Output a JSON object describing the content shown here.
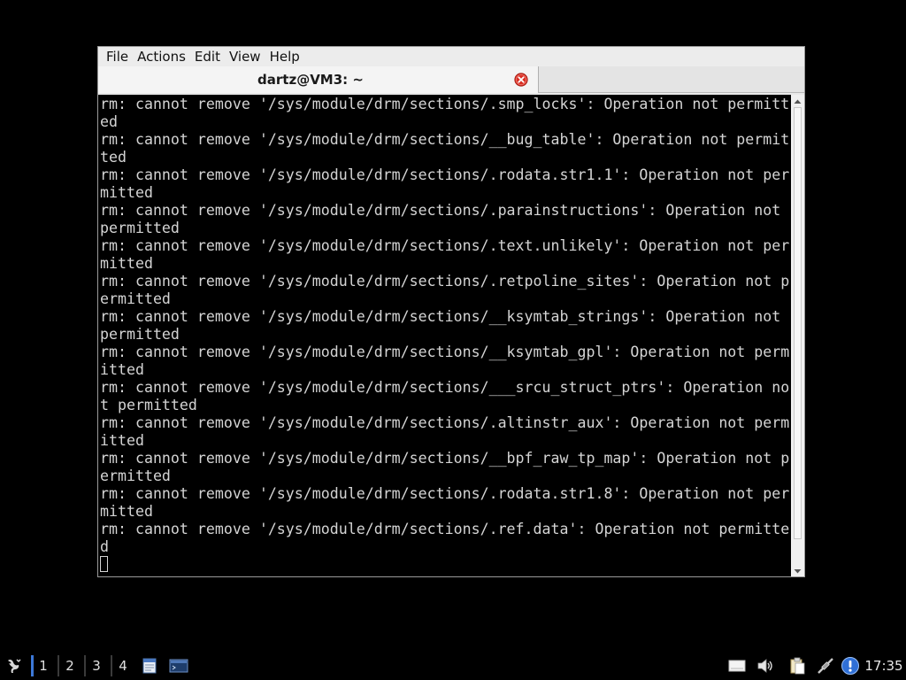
{
  "window": {
    "menu": [
      "File",
      "Actions",
      "Edit",
      "View",
      "Help"
    ],
    "tab_title": "dartz@VM3: ~"
  },
  "terminal": {
    "lines": [
      "rm: cannot remove '/sys/module/drm/sections/.smp_locks': Operation not permitt",
      "ed",
      "rm: cannot remove '/sys/module/drm/sections/__bug_table': Operation not permit",
      "ted",
      "rm: cannot remove '/sys/module/drm/sections/.rodata.str1.1': Operation not per",
      "mitted",
      "rm: cannot remove '/sys/module/drm/sections/.parainstructions': Operation not",
      "permitted",
      "rm: cannot remove '/sys/module/drm/sections/.text.unlikely': Operation not per",
      "mitted",
      "rm: cannot remove '/sys/module/drm/sections/.retpoline_sites': Operation not p",
      "ermitted",
      "rm: cannot remove '/sys/module/drm/sections/__ksymtab_strings': Operation not",
      "permitted",
      "rm: cannot remove '/sys/module/drm/sections/__ksymtab_gpl': Operation not perm",
      "itted",
      "rm: cannot remove '/sys/module/drm/sections/___srcu_struct_ptrs': Operation no",
      "t permitted",
      "rm: cannot remove '/sys/module/drm/sections/.altinstr_aux': Operation not perm",
      "itted",
      "rm: cannot remove '/sys/module/drm/sections/__bpf_raw_tp_map': Operation not p",
      "ermitted",
      "rm: cannot remove '/sys/module/drm/sections/.rodata.str1.8': Operation not per",
      "mitted",
      "rm: cannot remove '/sys/module/drm/sections/.ref.data': Operation not permitte",
      "d"
    ],
    "background": "#000000",
    "foreground": "#d4d4d4"
  },
  "taskbar": {
    "menu_icon": "start-menu-icon",
    "workspaces": [
      "1",
      "2",
      "3",
      "4"
    ],
    "active_workspace": "1",
    "launchers": [
      "file-manager-icon",
      "terminal-launcher-icon"
    ],
    "tray_icons": [
      "keyboard-icon",
      "volume-icon",
      "clipboard-icon",
      "network-icon",
      "update-notifier-icon"
    ],
    "clock": "17:35",
    "accent": "#3c78d8"
  }
}
